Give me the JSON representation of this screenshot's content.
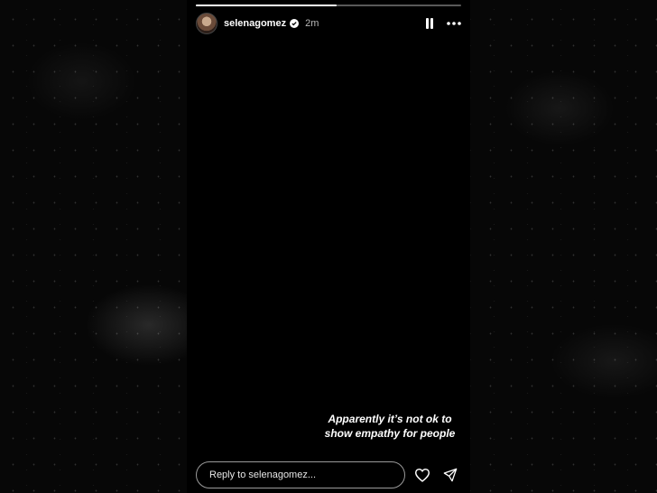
{
  "story": {
    "progress": 0.53,
    "username": "selenagomez",
    "verified": true,
    "time": "2m",
    "caption": "Apparently it’s not ok to show empathy for people",
    "reply": {
      "placeholder": "Reply to selenagomez..."
    }
  },
  "icons": {
    "pause": "pause-icon",
    "more": "more-icon",
    "like": "heart-icon",
    "share": "send-icon",
    "verified": "verified-badge-icon"
  },
  "colors": {
    "background": "#070707",
    "story_bg": "#000000",
    "verified": "#ffffff",
    "text": "#ffffff"
  }
}
